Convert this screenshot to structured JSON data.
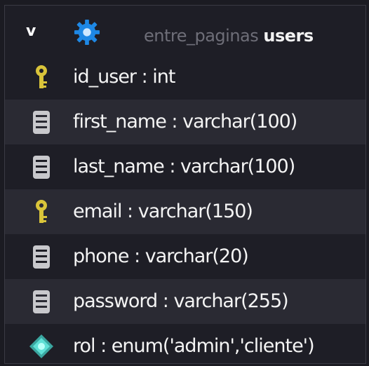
{
  "table_header": {
    "toggle": "v",
    "database": "entre_paginas",
    "table": "users",
    "icon": "gear-icon"
  },
  "columns": [
    {
      "label": "id_user : int",
      "icon": "key-icon"
    },
    {
      "label": "first_name : varchar(100)",
      "icon": "column-icon"
    },
    {
      "label": "last_name : varchar(100)",
      "icon": "column-icon"
    },
    {
      "label": "email : varchar(150)",
      "icon": "key-icon"
    },
    {
      "label": "phone : varchar(20)",
      "icon": "column-icon"
    },
    {
      "label": "password : varchar(255)",
      "icon": "column-icon"
    },
    {
      "label": "rol : enum('admin','cliente')",
      "icon": "enum-icon"
    }
  ],
  "colors": {
    "gear": "#1e88e5",
    "key": "#d9c43a",
    "column": "#c8c8cc",
    "enum": "#5fe0d6"
  }
}
